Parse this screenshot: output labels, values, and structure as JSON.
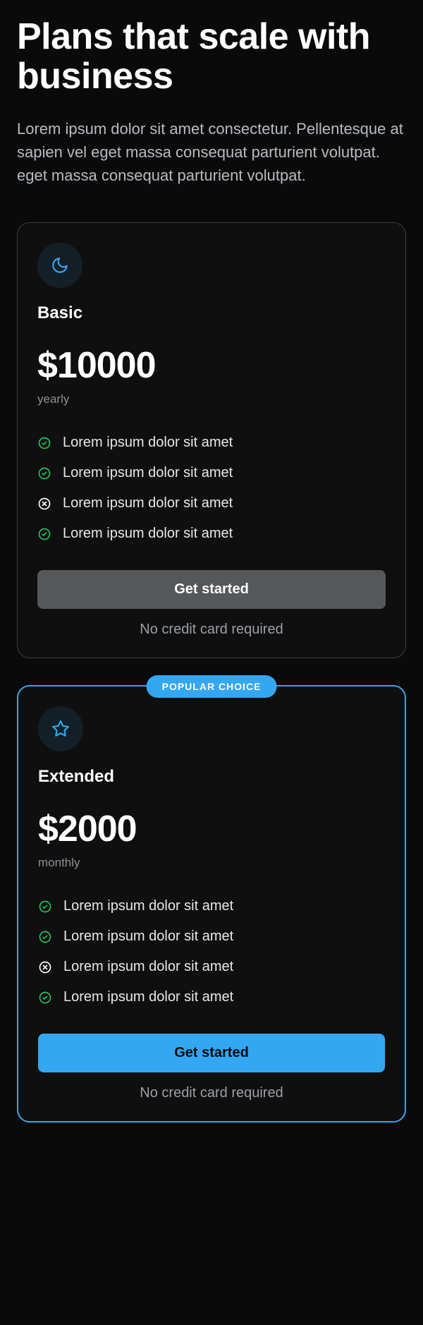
{
  "header": {
    "title": "Plans that scale with business",
    "subtitle": "Lorem ipsum dolor sit amet consectetur. Pellentesque at sapien vel eget massa consequat parturient volutpat. eget massa consequat parturient volutpat."
  },
  "popular_label": "POPULAR CHOICE",
  "plans": [
    {
      "icon": "moon",
      "name": "Basic",
      "price": "$10000",
      "period": "yearly",
      "popular": false,
      "cta_style": "gray",
      "cta": "Get started",
      "note": "No credit card required",
      "features": [
        {
          "included": true,
          "text": "Lorem ipsum dolor sit amet"
        },
        {
          "included": true,
          "text": "Lorem ipsum dolor sit amet"
        },
        {
          "included": false,
          "text": "Lorem ipsum dolor sit amet"
        },
        {
          "included": true,
          "text": "Lorem ipsum dolor sit amet"
        }
      ]
    },
    {
      "icon": "star",
      "name": "Extended",
      "price": "$2000",
      "period": "monthly",
      "popular": true,
      "cta_style": "blue",
      "cta": "Get started",
      "note": "No credit card required",
      "features": [
        {
          "included": true,
          "text": "Lorem ipsum dolor sit amet"
        },
        {
          "included": true,
          "text": "Lorem ipsum dolor sit amet"
        },
        {
          "included": false,
          "text": "Lorem ipsum dolor sit amet"
        },
        {
          "included": true,
          "text": "Lorem ipsum dolor sit amet"
        }
      ]
    }
  ]
}
